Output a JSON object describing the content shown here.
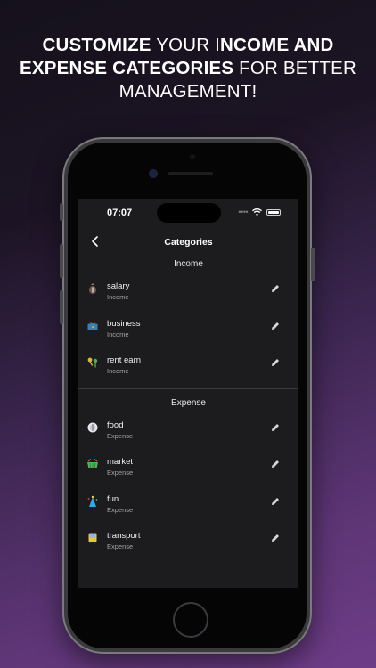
{
  "headline": {
    "line1": [
      "CUSTOMIZE",
      " YOUR I",
      "NCOME AND"
    ],
    "line2": [
      "EXPENSE CATEGORIES",
      " FOR BETTER"
    ],
    "line3": "MANAGEMENT!"
  },
  "status_bar": {
    "time": "07:07",
    "signal": "••••"
  },
  "nav": {
    "title": "Categories",
    "back_icon": "chevron-left-icon"
  },
  "sections": {
    "income": {
      "title": "Income",
      "items": [
        {
          "name": "salary",
          "type": "Income",
          "icon": "money-bag-icon"
        },
        {
          "name": "business",
          "type": "Income",
          "icon": "briefcase-icon"
        },
        {
          "name": "rent earn",
          "type": "Income",
          "icon": "keys-icon"
        }
      ]
    },
    "expense": {
      "title": "Expense",
      "items": [
        {
          "name": "food",
          "type": "Expense",
          "icon": "plate-icon"
        },
        {
          "name": "market",
          "type": "Expense",
          "icon": "basket-icon"
        },
        {
          "name": "fun",
          "type": "Expense",
          "icon": "party-icon"
        },
        {
          "name": "transport",
          "type": "Expense",
          "icon": "bus-icon"
        }
      ]
    }
  },
  "colors": {
    "screen_bg": "#1c1c1f",
    "accent": "#6e3d88"
  }
}
